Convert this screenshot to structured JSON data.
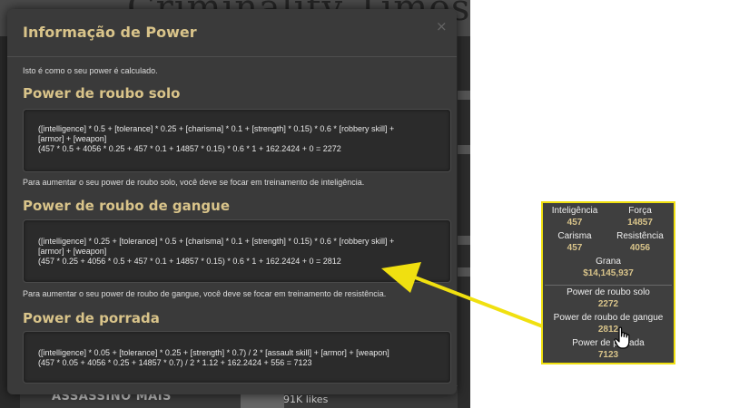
{
  "background": {
    "site_title": "Criminality Times",
    "section_title": "ASSASSINO MAIS",
    "likes_text": "91K likes"
  },
  "modal": {
    "title": "Informação de Power",
    "close_label": "×",
    "intro": "Isto é como o seu power é calculado.",
    "sections": [
      {
        "title": "Power de roubo solo",
        "formula_lines": [
          "([intelligence] * 0.5 + [tolerance] * 0.25 + [charisma] * 0.1 + [strength] * 0.15) * 0.6 * [robbery skill] +",
          "[armor] + [weapon]",
          "(457 * 0.5 + 4056 * 0.25 + 457 * 0.1 + 14857 * 0.15) * 0.6 * 1 + 162.2424 + 0 = 2272"
        ],
        "tip": "Para aumentar o seu power de roubo solo, você deve se focar em treinamento de inteligência."
      },
      {
        "title": "Power de roubo de gangue",
        "formula_lines": [
          "([intelligence] * 0.25 + [tolerance] * 0.5 + [charisma] * 0.1 + [strength] * 0.15) * 0.6 * [robbery skill] +",
          "[armor] + [weapon]",
          "(457 * 0.25 + 4056 * 0.5 + 457 * 0.1 + 14857 * 0.15) * 0.6 * 1 + 162.2424 + 0 = 2812"
        ],
        "tip": "Para aumentar o seu power de roubo de gangue, você deve se focar em treinamento de resistência."
      },
      {
        "title": "Power de porrada",
        "formula_lines": [
          "([intelligence] * 0.05 + [tolerance] * 0.25 + [strength] * 0.7) / 2 * [assault skill] + [armor] + [weapon]",
          "(457 * 0.05 + 4056 * 0.25 + 14857 * 0.7) / 2 * 1.12 + 162.2424 + 556 = 7123"
        ]
      }
    ]
  },
  "stats_panel": {
    "intelligence": {
      "label": "Inteligência",
      "value": "457"
    },
    "strength": {
      "label": "Força",
      "value": "14857"
    },
    "charisma": {
      "label": "Carisma",
      "value": "457"
    },
    "tolerance": {
      "label": "Resistência",
      "value": "4056"
    },
    "cash": {
      "label": "Grana",
      "value": "$14,145,937"
    },
    "powers": [
      {
        "label": "Power de roubo solo",
        "value": "2272"
      },
      {
        "label": "Power de roubo de gangue",
        "value": "2812"
      },
      {
        "label": "Power de porrada",
        "value": "7123"
      }
    ]
  },
  "colors": {
    "accent_gold": "#d9c48a",
    "highlight_yellow": "#f0e010",
    "modal_bg": "#3a3a3a",
    "box_bg": "#2b2b2b"
  },
  "icons": [
    "close-icon",
    "hand-cursor-icon",
    "arrow-annotation"
  ]
}
